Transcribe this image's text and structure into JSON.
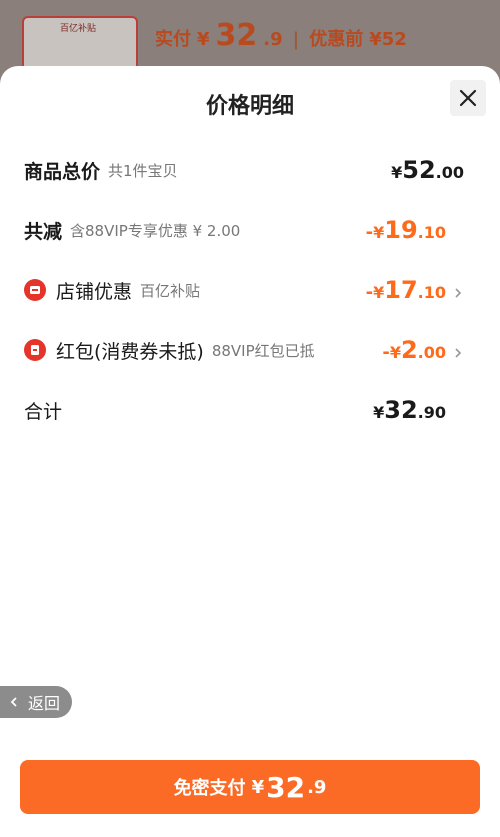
{
  "background": {
    "thumb_tag": "百亿补贴",
    "price_label": "实付",
    "currency": "¥",
    "price_int": "32",
    "price_dec": ".9",
    "before_label": "优惠前",
    "before_price": "¥52"
  },
  "sheet": {
    "title": "价格明细",
    "rows": [
      {
        "name": "商品总价",
        "desc": "共1件宝贝",
        "yen": "¥",
        "int": "52",
        "dec": ".00"
      },
      {
        "name": "共减",
        "desc": "含88VIP专享优惠 ¥ 2.00",
        "sign": "-",
        "yen": "¥",
        "int": "19",
        "dec": ".10"
      },
      {
        "name": "店铺优惠",
        "desc": "百亿补贴",
        "sign": "-",
        "yen": "¥",
        "int": "17",
        "dec": ".10",
        "icon": "shop-icon"
      },
      {
        "name": "红包(消费券未抵)",
        "desc": "88VIP红包已抵",
        "sign": "-",
        "yen": "¥",
        "int": "2",
        "dec": ".00",
        "icon": "red-packet-icon"
      },
      {
        "name": "合计",
        "desc": "",
        "yen": "¥",
        "int": "32",
        "dec": ".90"
      }
    ],
    "back_label": "返回",
    "pay": {
      "label": "免密支付",
      "yen": "¥",
      "int": "32",
      "dec": ".9"
    }
  },
  "colors": {
    "accent": "#ff6a1a",
    "button": "#fb6b25",
    "icon_red": "#e5352b"
  }
}
